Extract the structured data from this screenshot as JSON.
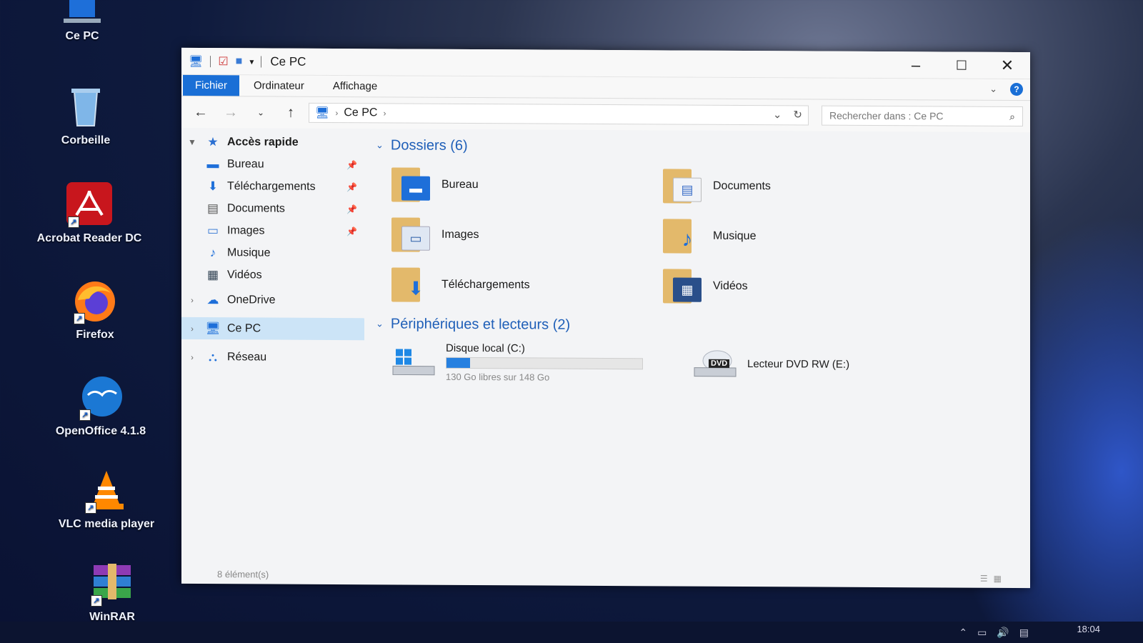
{
  "desktop": {
    "icons": [
      {
        "label": "Ce PC",
        "icon": "computer-icon"
      },
      {
        "label": "Corbeille",
        "icon": "recycle-bin-icon"
      },
      {
        "label": "Acrobat Reader DC",
        "icon": "acrobat-icon"
      },
      {
        "label": "Firefox",
        "icon": "firefox-icon"
      },
      {
        "label": "OpenOffice 4.1.8",
        "icon": "openoffice-icon"
      },
      {
        "label": "VLC media player",
        "icon": "vlc-icon"
      },
      {
        "label": "WinRAR",
        "icon": "winrar-icon"
      }
    ]
  },
  "window": {
    "title": "Ce PC",
    "ribbon_tabs": [
      "Fichier",
      "Ordinateur",
      "Affichage"
    ],
    "address": {
      "path": "Ce PC"
    },
    "search": {
      "placeholder": "Rechercher dans : Ce PC"
    },
    "sidebar": {
      "quick_access": "Accès rapide",
      "items": [
        {
          "label": "Bureau",
          "icon": "desktop-icon",
          "pinned": true
        },
        {
          "label": "Téléchargements",
          "icon": "download-icon",
          "pinned": true
        },
        {
          "label": "Documents",
          "icon": "document-icon",
          "pinned": true
        },
        {
          "label": "Images",
          "icon": "image-icon",
          "pinned": true
        },
        {
          "label": "Musique",
          "icon": "music-icon",
          "pinned": false
        },
        {
          "label": "Vidéos",
          "icon": "video-icon",
          "pinned": false
        }
      ],
      "onedrive": "OneDrive",
      "ce_pc": "Ce PC",
      "reseau": "Réseau"
    },
    "folders_header": "Dossiers (6)",
    "folders": [
      {
        "label": "Bureau",
        "icon": "desktop-icon"
      },
      {
        "label": "Documents",
        "icon": "document-icon"
      },
      {
        "label": "Images",
        "icon": "image-icon"
      },
      {
        "label": "Musique",
        "icon": "music-icon"
      },
      {
        "label": "Téléchargements",
        "icon": "download-icon"
      },
      {
        "label": "Vidéos",
        "icon": "video-icon"
      }
    ],
    "devices_header": "Périphériques et lecteurs (2)",
    "drives": {
      "c": {
        "label": "Disque local (C:)",
        "free": "130 Go libres sur 148 Go",
        "used_fraction": 0.12
      },
      "e": {
        "label": "Lecteur DVD RW (E:)",
        "badge": "DVD"
      }
    },
    "status": "8 élément(s)"
  },
  "taskbar": {
    "time": "18:04"
  },
  "colors": {
    "accent": "#1a6fd6",
    "folder": "#e3b96b",
    "group_header": "#1f5fb8"
  }
}
